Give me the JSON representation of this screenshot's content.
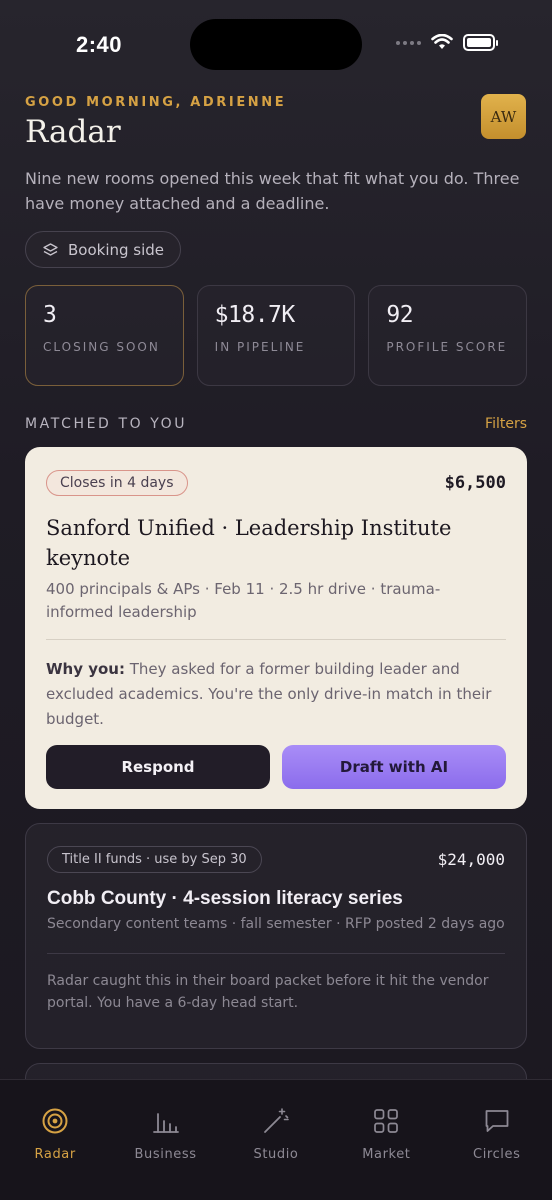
{
  "status_bar": {
    "time": "2:40"
  },
  "header": {
    "greeting": "GOOD MORNING, ADRIENNE",
    "title": "Radar",
    "avatar_initials": "AW",
    "subtitle": "Nine new rooms opened this week that fit what you do. Three have money attached and a deadline.",
    "booking_chip": "Booking side"
  },
  "stats": [
    {
      "value": "3",
      "label": "CLOSING SOON"
    },
    {
      "value": "$18.7K",
      "label": "IN PIPELINE"
    },
    {
      "value": "92",
      "label": "PROFILE SCORE"
    }
  ],
  "section": {
    "title": "MATCHED TO YOU",
    "filters_label": "Filters"
  },
  "featured": {
    "badge": "Closes in 4 days",
    "price": "$6,500",
    "title": "Sanford Unified · Leadership Institute keynote",
    "meta": "400 principals & APs · Feb 11 · 2.5 hr drive · trauma-informed leadership",
    "why_label": "Why you:",
    "why_text": " They asked for a former building leader and excluded academics. You're the only drive-in match in their budget.",
    "respond_label": "Respond",
    "draft_label": "Draft with AI"
  },
  "second": {
    "badge": "Title II funds · use by Sep 30",
    "price": "$24,000",
    "title": "Cobb County · 4-session literacy series",
    "meta": "Secondary content teams · fall semester · RFP posted 2 days ago",
    "note": "Radar caught this in their board packet before it hit the vendor portal. You have a 6-day head start."
  },
  "tabs": [
    {
      "label": "Radar",
      "icon": "radar-icon",
      "active": true
    },
    {
      "label": "Business",
      "icon": "bar-chart-icon",
      "active": false
    },
    {
      "label": "Studio",
      "icon": "magic-wand-icon",
      "active": false
    },
    {
      "label": "Market",
      "icon": "grid-icon",
      "active": false
    },
    {
      "label": "Circles",
      "icon": "chat-icon",
      "active": false
    }
  ],
  "colors": {
    "accent": "#d6a244",
    "ai_button": "#9a7cf2",
    "card_light": "#f2ece1"
  }
}
